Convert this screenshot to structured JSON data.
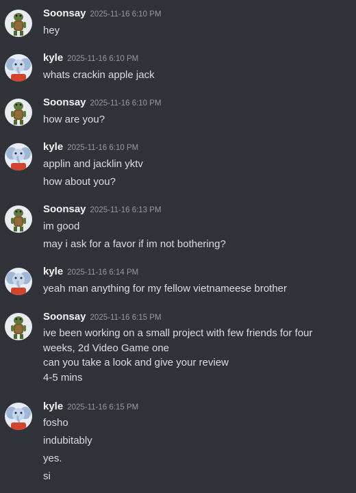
{
  "colors": {
    "background": "#313338",
    "author": "#f2f3f5",
    "timestamp": "#949ba4",
    "text": "#dbdee1"
  },
  "users": {
    "soonsay": {
      "name": "Soonsay",
      "avatar_icon": "frog-character-avatar-icon"
    },
    "kyle": {
      "name": "kyle",
      "avatar_icon": "elephant-character-avatar-icon"
    }
  },
  "messages": [
    {
      "author": "Soonsay",
      "timestamp": "2025-11-16 6:10 PM",
      "lines": [
        "hey"
      ]
    },
    {
      "author": "kyle",
      "timestamp": "2025-11-16 6:10 PM",
      "lines": [
        "whats crackin apple jack"
      ]
    },
    {
      "author": "Soonsay",
      "timestamp": "2025-11-16 6:10 PM",
      "lines": [
        "how are you?"
      ]
    },
    {
      "author": "kyle",
      "timestamp": "2025-11-16 6:10 PM",
      "lines": [
        "applin and jacklin yktv",
        "how about you?"
      ]
    },
    {
      "author": "Soonsay",
      "timestamp": "2025-11-16 6:13 PM",
      "lines": [
        "im good",
        "may i ask for a favor if im not bothering?"
      ]
    },
    {
      "author": "kyle",
      "timestamp": "2025-11-16 6:14 PM",
      "lines": [
        "yeah man anything for my fellow vietnameese brother"
      ]
    },
    {
      "author": "Soonsay",
      "timestamp": "2025-11-16 6:15 PM",
      "lines": [
        "ive been working on a small project with few friends for four weeks, 2d Video Game one",
        "can you take a look and give your review",
        "4-5 mins"
      ]
    },
    {
      "author": "kyle",
      "timestamp": "2025-11-16 6:15 PM",
      "lines": [
        "fosho",
        "indubitably",
        "yes.",
        "si"
      ]
    }
  ]
}
